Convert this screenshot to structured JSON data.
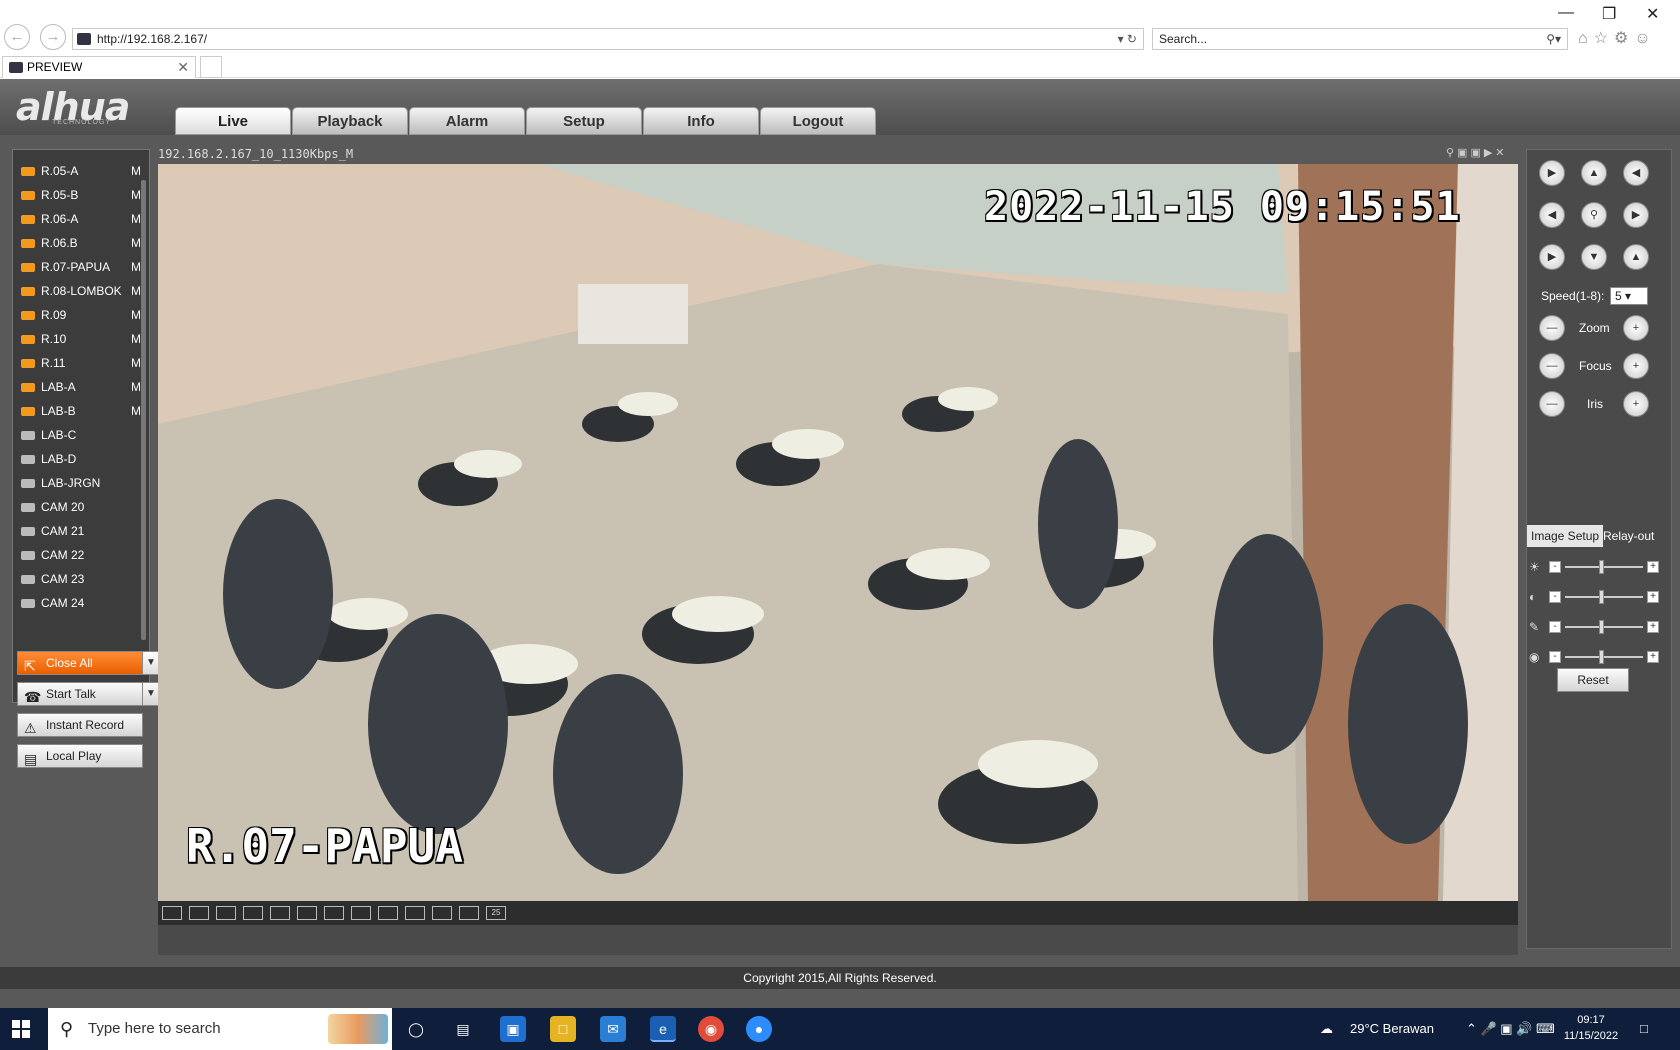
{
  "browser": {
    "address": "http://192.168.2.167/",
    "search_placeholder": "Search...",
    "tab_title": "PREVIEW"
  },
  "app": {
    "logo": "alhua",
    "logo_sub": "TECHNOLOGY",
    "menu": [
      {
        "label": "Live"
      },
      {
        "label": "Playback"
      },
      {
        "label": "Alarm"
      },
      {
        "label": "Setup"
      },
      {
        "label": "Info"
      },
      {
        "label": "Logout"
      }
    ]
  },
  "cameras": [
    {
      "label": "R.05-A",
      "mode": "M",
      "active": true
    },
    {
      "label": "R.05-B",
      "mode": "M",
      "active": true
    },
    {
      "label": "R.06-A",
      "mode": "M",
      "active": true
    },
    {
      "label": "R.06.B",
      "mode": "M",
      "active": true
    },
    {
      "label": "R.07-PAPUA",
      "mode": "M",
      "active": true
    },
    {
      "label": "R.08-LOMBOK",
      "mode": "M",
      "active": true
    },
    {
      "label": "R.09",
      "mode": "M",
      "active": true
    },
    {
      "label": "R.10",
      "mode": "M",
      "active": true
    },
    {
      "label": "R.11",
      "mode": "M",
      "active": true
    },
    {
      "label": "LAB-A",
      "mode": "M",
      "active": true
    },
    {
      "label": "LAB-B",
      "mode": "M",
      "active": true
    },
    {
      "label": "LAB-C",
      "mode": "",
      "active": false
    },
    {
      "label": "LAB-D",
      "mode": "",
      "active": false
    },
    {
      "label": "LAB-JRGN",
      "mode": "",
      "active": false
    },
    {
      "label": "CAM 20",
      "mode": "",
      "active": false
    },
    {
      "label": "CAM 21",
      "mode": "",
      "active": false
    },
    {
      "label": "CAM 22",
      "mode": "",
      "active": false
    },
    {
      "label": "CAM 23",
      "mode": "",
      "active": false
    },
    {
      "label": "CAM 24",
      "mode": "",
      "active": false
    }
  ],
  "actions": {
    "close_all": "Close All",
    "start_talk": "Start Talk",
    "instant_record": "Instant Record",
    "local_play": "Local Play"
  },
  "video": {
    "stream_title": "192.168.2.167_10_1130Kbps_M",
    "osd_datetime": "2022-11-15 09:15:51",
    "osd_name": "R.07-PAPUA",
    "layout_last": "25"
  },
  "ptz": {
    "speed_label": "Speed(1-8):",
    "speed_value": "5",
    "zoom": "Zoom",
    "focus": "Focus",
    "iris": "Iris",
    "tab_image": "Image Setup",
    "tab_relay": "Relay-out",
    "reset": "Reset",
    "sliders": [
      {
        "name": "brightness",
        "level": 0.5
      },
      {
        "name": "contrast",
        "level": 0.5
      },
      {
        "name": "saturation",
        "level": 0.5
      },
      {
        "name": "hue",
        "level": 0.5
      }
    ]
  },
  "footer": "Copyright 2015,All Rights Reserved.",
  "taskbar": {
    "search": "Type here to search",
    "weather": "29°C Berawan",
    "time": "09:17",
    "date": "11/15/2022"
  }
}
